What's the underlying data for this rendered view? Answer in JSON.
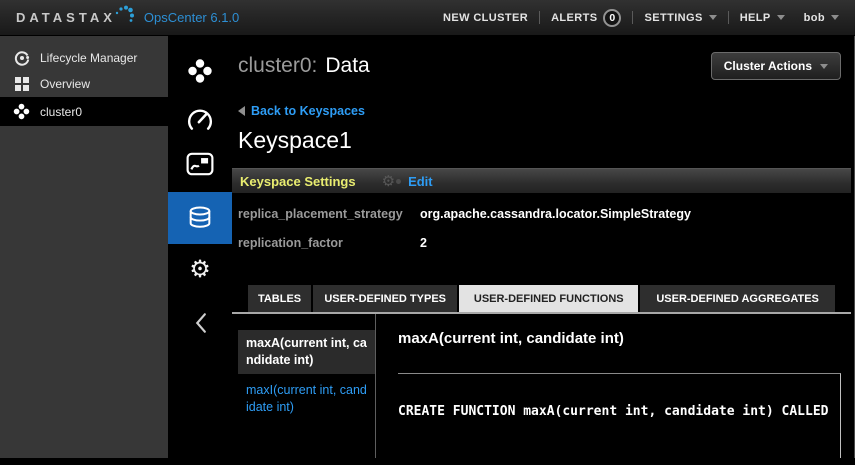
{
  "topbar": {
    "brand": "DATASTAX",
    "product": "OpsCenter 6.1.0",
    "new_cluster": "NEW CLUSTER",
    "alerts_label": "ALERTS",
    "alerts_count": "0",
    "settings_label": "SETTINGS",
    "help_label": "HELP",
    "user_name": "bob"
  },
  "sidebar": {
    "items": [
      {
        "label": "Lifecycle Manager",
        "icon": "lifecycle-manager-icon"
      },
      {
        "label": "Overview",
        "icon": "overview-grid-icon"
      },
      {
        "label": "cluster0",
        "icon": "cluster-icon",
        "selected": true
      }
    ]
  },
  "rail": {
    "icons": [
      "cluster-icon",
      "dashboard-gauge-icon",
      "activities-icon",
      "data-database-icon",
      "settings-gear-icon",
      "collapse-chevron-icon"
    ],
    "active_icon": "data-database-icon"
  },
  "icons": {
    "gear_glyph": "⚙"
  },
  "header": {
    "cluster_prefix": "cluster0:",
    "page_title": "Data",
    "cluster_actions": "Cluster Actions"
  },
  "keyspace": {
    "back_link": "Back to Keyspaces",
    "name": "Keyspace1",
    "settings_title": "Keyspace Settings",
    "edit_label": "Edit",
    "properties": [
      {
        "label": "replica_placement_strategy",
        "value": "org.apache.cassandra.locator.SimpleStrategy"
      },
      {
        "label": "replication_factor",
        "value": "2"
      }
    ]
  },
  "tabs": [
    {
      "label": "TABLES",
      "active": false
    },
    {
      "label": "USER-DEFINED TYPES",
      "active": false
    },
    {
      "label": "USER-DEFINED FUNCTIONS",
      "active": true
    },
    {
      "label": "USER-DEFINED AGGREGATES",
      "active": false
    }
  ],
  "functions": {
    "list": [
      {
        "label": "maxA(current int, candidate int)",
        "selected": true
      },
      {
        "label": "maxI(current int, candidate int)",
        "selected": false
      }
    ],
    "detail_title": "maxA(current int, candidate int)",
    "code": "CREATE FUNCTION maxA(current int, candidate int) CALLED"
  },
  "colors": {
    "accent_blue": "#1563b3",
    "link_blue": "#2e9df5",
    "highlight_yellow": "#e9ed70",
    "brand_teal": "#2d9fd8"
  }
}
